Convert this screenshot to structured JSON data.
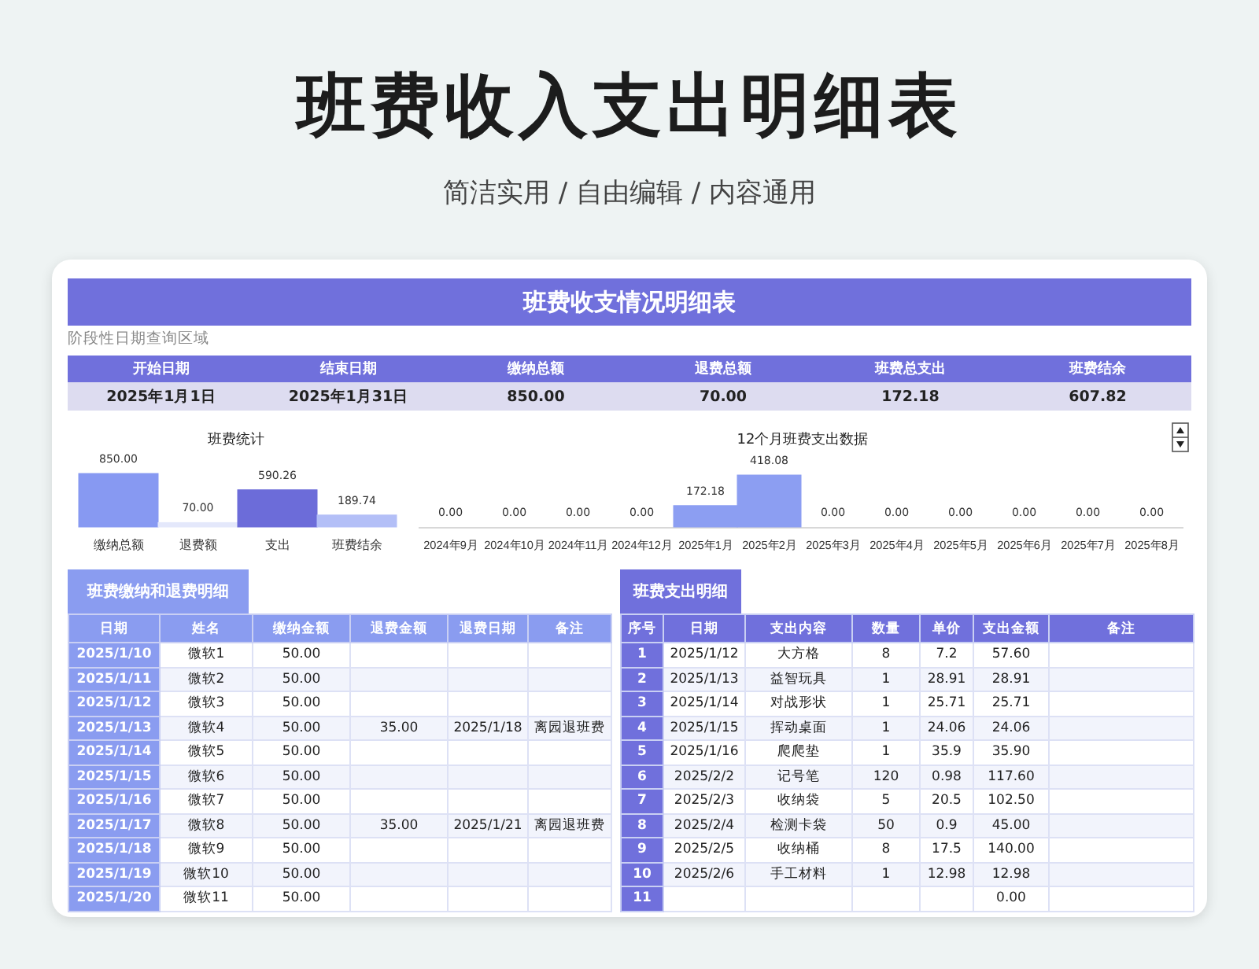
{
  "title": "班费收入支出明细表",
  "subtitle": "简洁实用 / 自由编辑 / 内容通用",
  "sheet": {
    "banner": "班费收支情况明细表",
    "query_caption": "阶段性日期查询区域",
    "summary": [
      {
        "label": "开始日期",
        "value": "2025年1月1日"
      },
      {
        "label": "结束日期",
        "value": "2025年1月31日"
      },
      {
        "label": "缴纳总额",
        "value": "850.00"
      },
      {
        "label": "退费总额",
        "value": "70.00"
      },
      {
        "label": "班费总支出",
        "value": "172.18"
      },
      {
        "label": "班费结余",
        "value": "607.82"
      }
    ],
    "charts": [
      {
        "chart_data": {
          "type": "bar",
          "title": "班费统计",
          "categories": [
            "缴纳总额",
            "退费额",
            "支出",
            "班费结余"
          ],
          "stacked": true,
          "series": [
            {
              "color": "#8799f2",
              "values": [
                850,
                null,
                null,
                null
              ],
              "value_labels": [
                "850.00",
                null,
                null,
                null
              ]
            },
            {
              "color": "#e4e8fb",
              "values": [
                null,
                70,
                null,
                null
              ],
              "value_labels": [
                null,
                "70.00",
                null,
                null
              ]
            },
            {
              "color": "#6c6cd9",
              "values": [
                null,
                null,
                590.26,
                null
              ],
              "value_labels": [
                null,
                null,
                "590.26",
                null
              ]
            },
            {
              "color": "#b3bff7",
              "values": [
                null,
                null,
                null,
                189.74
              ],
              "value_labels": [
                null,
                null,
                null,
                "189.74"
              ]
            }
          ]
        }
      },
      {
        "chart_data": {
          "type": "bar",
          "title": "12个月班费支出数据",
          "categories": [
            "2024年9月",
            "2024年10月",
            "2024年11月",
            "2024年12月",
            "2025年1月",
            "2025年2月",
            "2025年3月",
            "2025年4月",
            "2025年5月",
            "2025年6月",
            "2025年7月",
            "2025年8月"
          ],
          "series": [
            {
              "color": "#8c9ef2",
              "values": [
                0,
                0,
                0,
                0,
                172.18,
                418.08,
                0,
                0,
                0,
                0,
                0,
                0
              ],
              "value_labels": [
                "0.00",
                "0.00",
                "0.00",
                "0.00",
                "172.18",
                "418.08",
                "0.00",
                "0.00",
                "0.00",
                "0.00",
                "0.00",
                "0.00"
              ]
            }
          ]
        }
      }
    ],
    "payments": {
      "title": "班费缴纳和退费明细",
      "columns": [
        "日期",
        "姓名",
        "缴纳金额",
        "退费金额",
        "退费日期",
        "备注"
      ],
      "rows": [
        {
          "date": "2025/1/10",
          "name": "微软1",
          "paid": "50.00"
        },
        {
          "date": "2025/1/11",
          "name": "微软2",
          "paid": "50.00"
        },
        {
          "date": "2025/1/12",
          "name": "微软3",
          "paid": "50.00"
        },
        {
          "date": "2025/1/13",
          "name": "微软4",
          "paid": "50.00",
          "refund": "35.00",
          "refund_date": "2025/1/18",
          "note": "离园退班费"
        },
        {
          "date": "2025/1/14",
          "name": "微软5",
          "paid": "50.00"
        },
        {
          "date": "2025/1/15",
          "name": "微软6",
          "paid": "50.00"
        },
        {
          "date": "2025/1/16",
          "name": "微软7",
          "paid": "50.00"
        },
        {
          "date": "2025/1/17",
          "name": "微软8",
          "paid": "50.00",
          "refund": "35.00",
          "refund_date": "2025/1/21",
          "note": "离园退班费"
        },
        {
          "date": "2025/1/18",
          "name": "微软9",
          "paid": "50.00"
        },
        {
          "date": "2025/1/19",
          "name": "微软10",
          "paid": "50.00"
        },
        {
          "date": "2025/1/20",
          "name": "微软11",
          "paid": "50.00"
        }
      ]
    },
    "expenses": {
      "title": "班费支出明细",
      "columns": [
        "序号",
        "日期",
        "支出内容",
        "数量",
        "单价",
        "支出金额",
        "备注"
      ],
      "rows": [
        {
          "no": "1",
          "date": "2025/1/12",
          "item": "大方格",
          "qty": "8",
          "price": "7.2",
          "amount": "57.60"
        },
        {
          "no": "2",
          "date": "2025/1/13",
          "item": "益智玩具",
          "qty": "1",
          "price": "28.91",
          "amount": "28.91"
        },
        {
          "no": "3",
          "date": "2025/1/14",
          "item": "对战形状",
          "qty": "1",
          "price": "25.71",
          "amount": "25.71"
        },
        {
          "no": "4",
          "date": "2025/1/15",
          "item": "挥动桌面",
          "qty": "1",
          "price": "24.06",
          "amount": "24.06"
        },
        {
          "no": "5",
          "date": "2025/1/16",
          "item": "爬爬垫",
          "qty": "1",
          "price": "35.9",
          "amount": "35.90"
        },
        {
          "no": "6",
          "date": "2025/2/2",
          "item": "记号笔",
          "qty": "120",
          "price": "0.98",
          "amount": "117.60"
        },
        {
          "no": "7",
          "date": "2025/2/3",
          "item": "收纳袋",
          "qty": "5",
          "price": "20.5",
          "amount": "102.50"
        },
        {
          "no": "8",
          "date": "2025/2/4",
          "item": "检测卡袋",
          "qty": "50",
          "price": "0.9",
          "amount": "45.00"
        },
        {
          "no": "9",
          "date": "2025/2/5",
          "item": "收纳桶",
          "qty": "8",
          "price": "17.5",
          "amount": "140.00"
        },
        {
          "no": "10",
          "date": "2025/2/6",
          "item": "手工材料",
          "qty": "1",
          "price": "12.98",
          "amount": "12.98"
        },
        {
          "no": "11",
          "amount": "0.00"
        }
      ]
    }
  }
}
